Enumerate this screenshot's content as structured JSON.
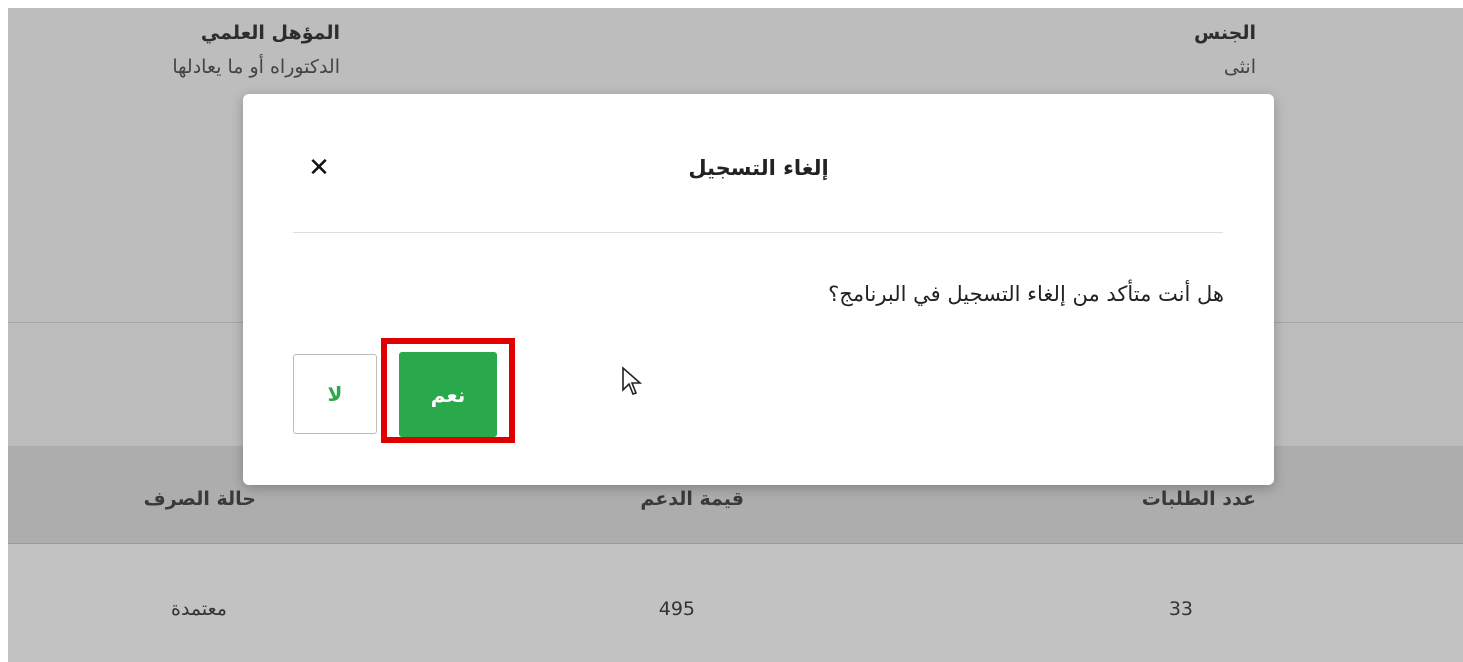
{
  "background_page": {
    "info": {
      "qualification_label": "المؤهل العلمي",
      "qualification_value": "الدكتوراه أو ما يعادلها",
      "gender_label": "الجنس",
      "gender_value": "انثى"
    },
    "table": {
      "headers": [
        "عدد الطلبات",
        "قيمة الدعم",
        "حالة الصرف"
      ],
      "rows": [
        [
          "33",
          "495",
          "معتمدة"
        ]
      ]
    }
  },
  "modal": {
    "title": "إلغاء التسجيل",
    "message": "هل أنت متأكد من إلغاء التسجيل في البرنامج؟",
    "yes_label": "نعم",
    "no_label": "لا",
    "close_icon": "close-icon"
  },
  "colors": {
    "overlay": "#bdbdbd",
    "primary_button": "#2aa84c",
    "highlight": "#e10000"
  }
}
